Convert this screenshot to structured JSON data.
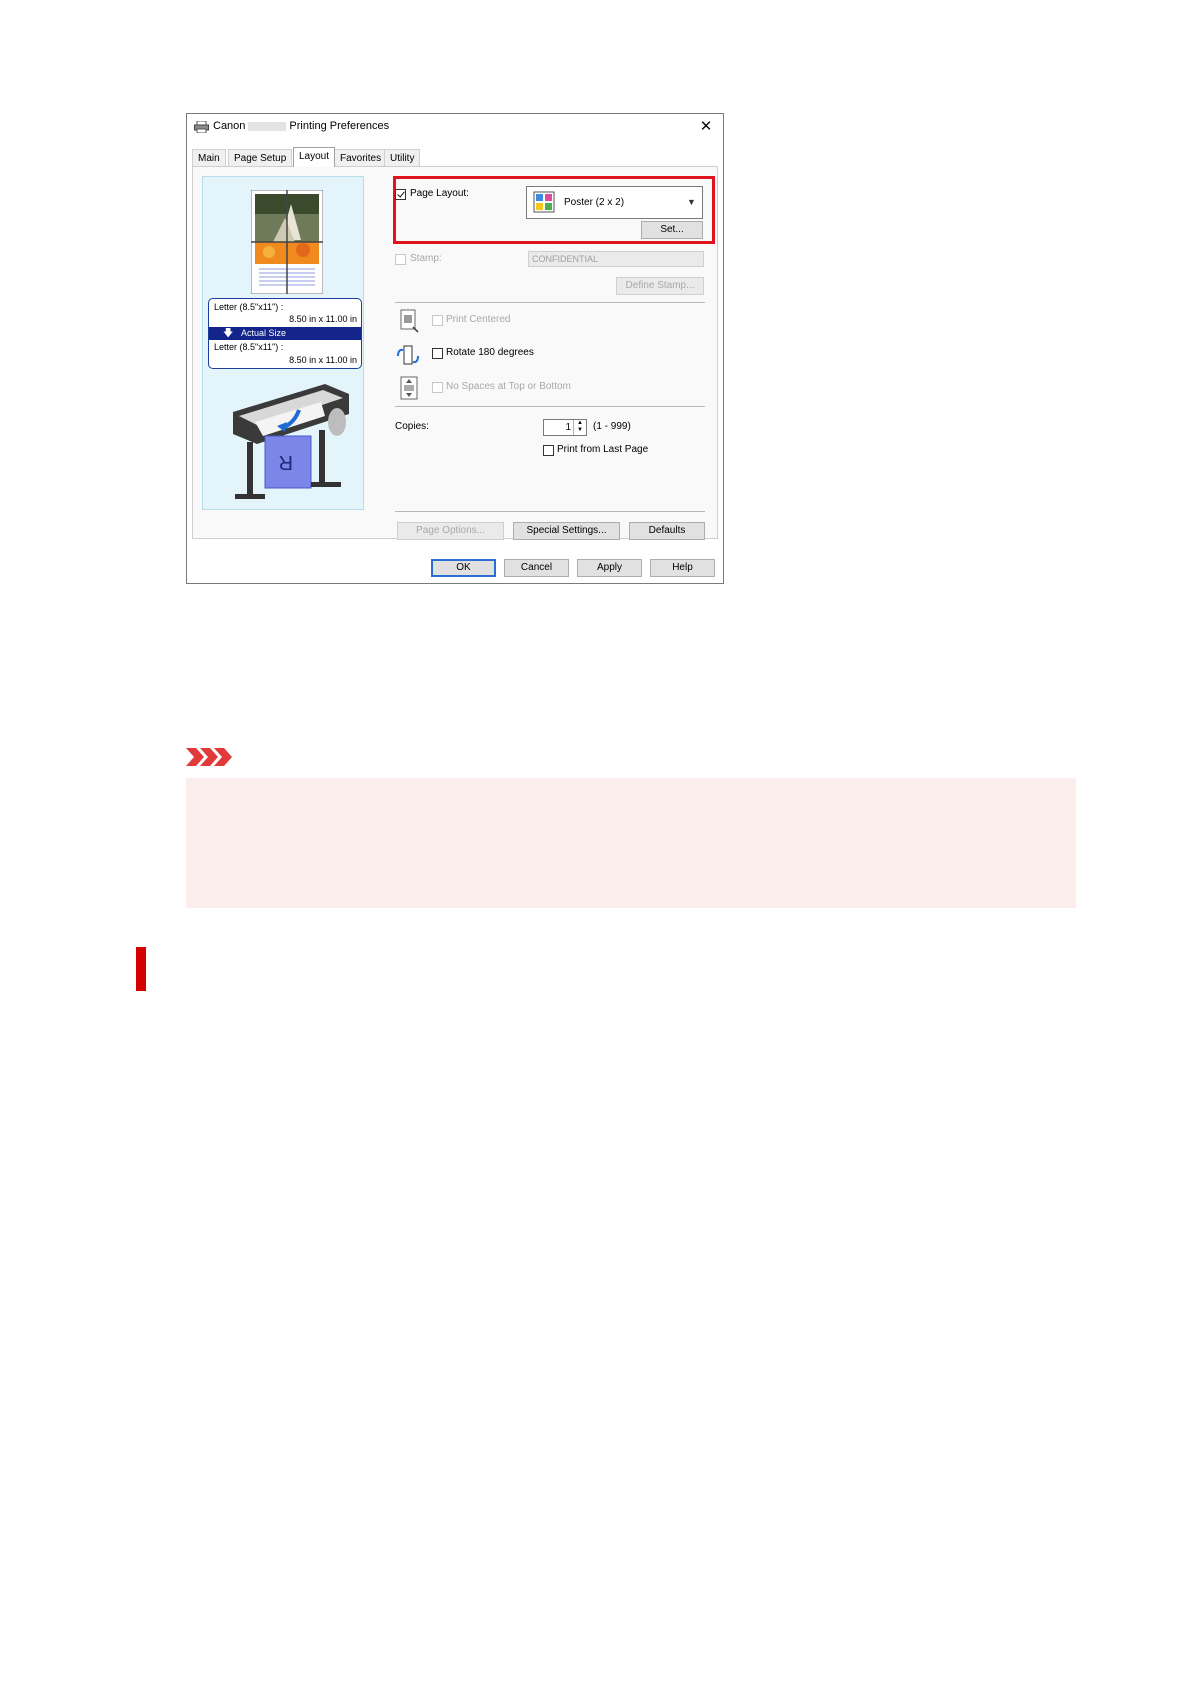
{
  "dialog": {
    "title_prefix": "Canon",
    "title_suffix": "Printing Preferences",
    "close": "✕",
    "tabs": [
      "Main",
      "Page Setup",
      "Layout",
      "Favorites",
      "Utility"
    ],
    "active_tab": "Layout"
  },
  "preview": {
    "input_size": "Letter (8.5\"x11\") :",
    "input_dims": "8.50 in x 11.00 in",
    "scaling": "Actual Size",
    "output_size": "Letter (8.5\"x11\") :",
    "output_dims": "8.50 in x 11.00 in"
  },
  "layout": {
    "page_layout_label": "Page Layout:",
    "page_layout_value": "Poster (2 x 2)",
    "set_button": "Set...",
    "stamp_label": "Stamp:",
    "stamp_value": "CONFIDENTIAL",
    "define_stamp_button": "Define Stamp...",
    "print_centered": "Print Centered",
    "rotate_180": "Rotate 180 degrees",
    "no_spaces": "No Spaces at Top or Bottom",
    "copies_label": "Copies:",
    "copies_value": "1",
    "copies_range": "(1 - 999)",
    "print_from_last": "Print from Last Page",
    "page_options_button": "Page Options...",
    "special_settings_button": "Special Settings...",
    "defaults_button": "Defaults"
  },
  "footer": {
    "ok": "OK",
    "cancel": "Cancel",
    "apply": "Apply",
    "help": "Help"
  },
  "colors": {
    "highlight": "#e0141e",
    "warning_bg": "#fdeeee",
    "section_bar": "#d40000"
  }
}
